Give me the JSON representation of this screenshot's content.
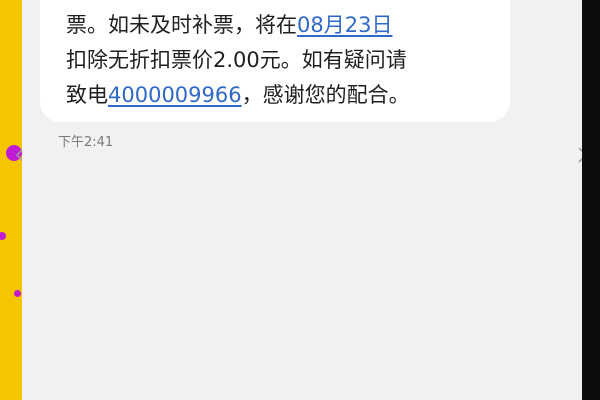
{
  "message": {
    "line1_prefix": "票。如未及时补票，将在",
    "date_link": "08月23日",
    "line2": "扣除无折扣票价2.00元。如有疑问请",
    "line3_prefix": "致电",
    "phone_link": "4000009966",
    "line3_suffix": "，感谢您的配合。"
  },
  "timestamp": "下午2:41",
  "colors": {
    "link": "#2e68c8",
    "left_background": "#f7c400",
    "left_dots": "#c21bd6",
    "bubble": "#ffffff",
    "screen_background": "#f1f1f3"
  },
  "icons": {
    "left": "chevron-left-icon",
    "right": "chevron-right-icon"
  }
}
